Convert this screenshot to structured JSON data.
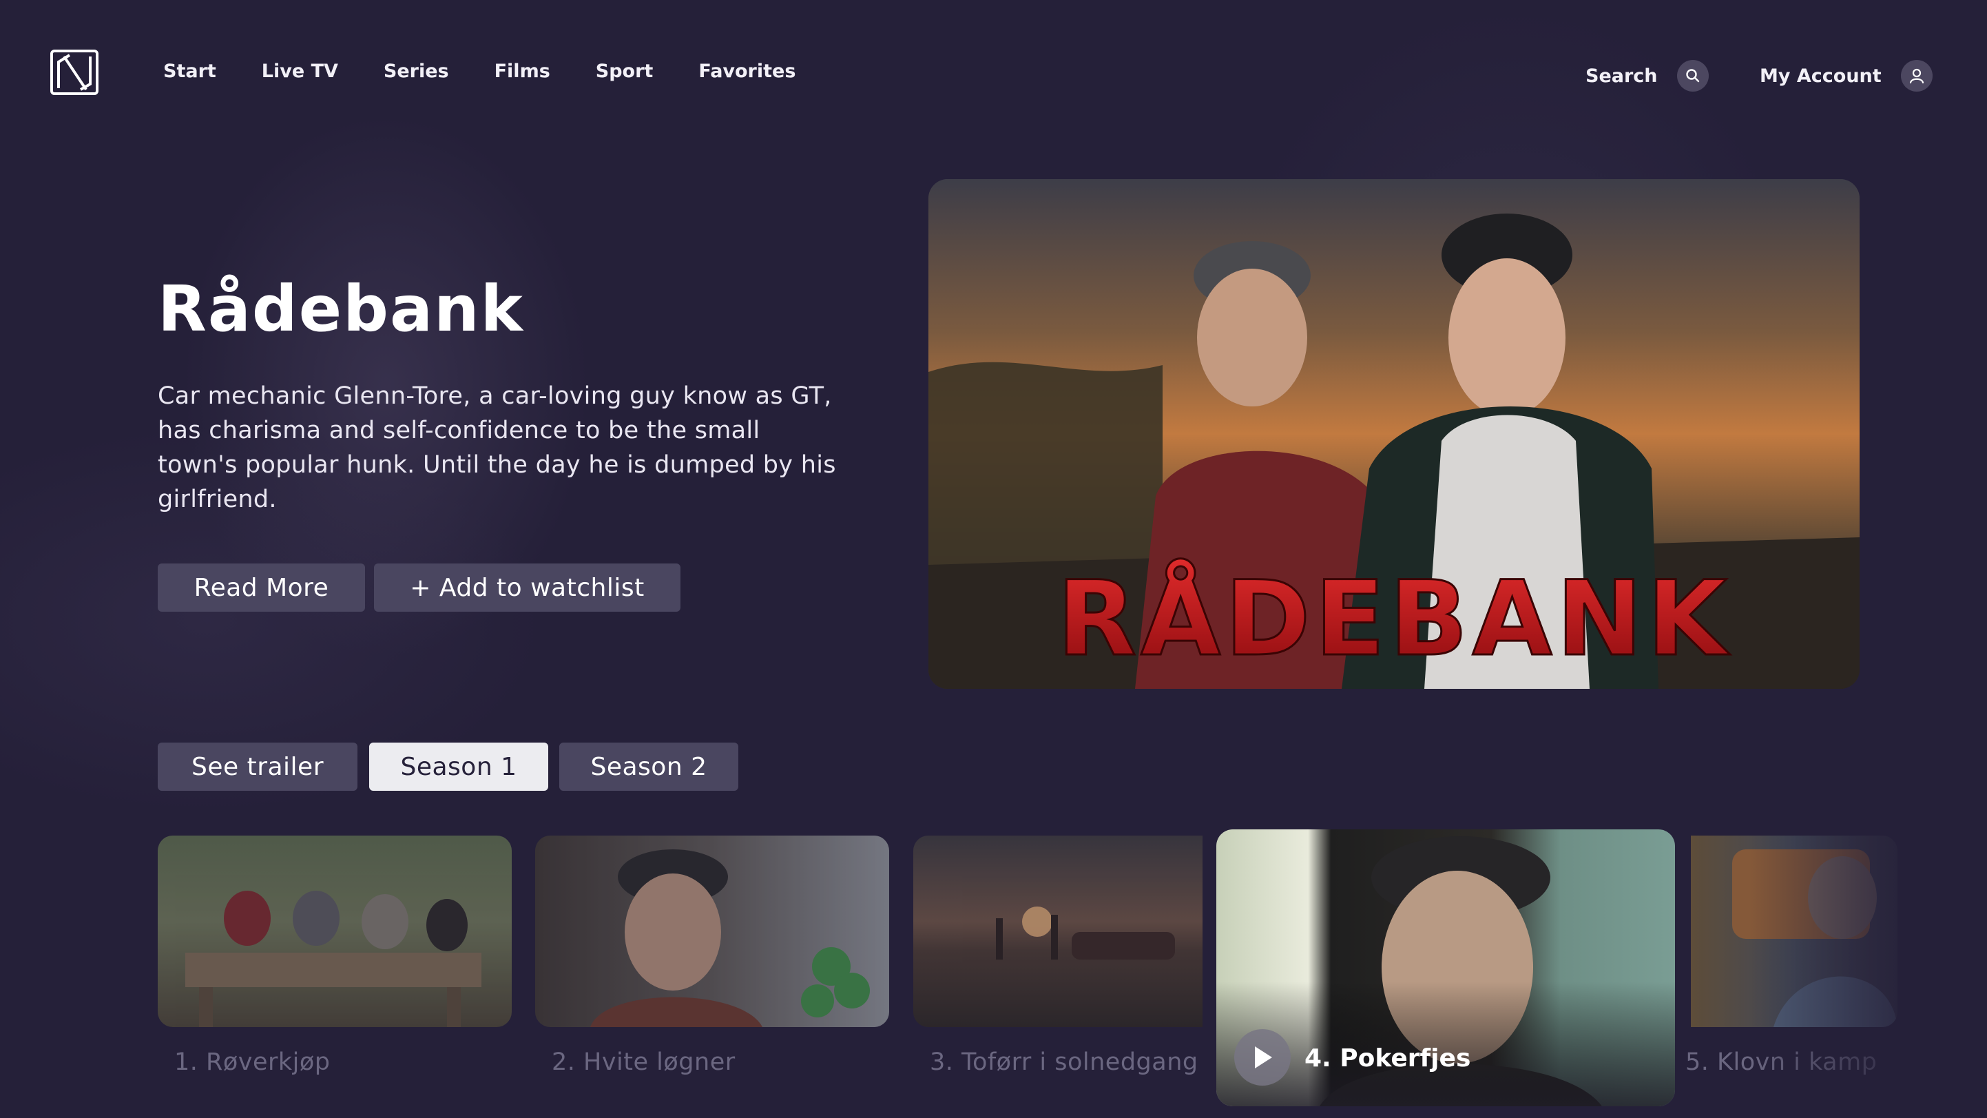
{
  "nav": {
    "items": [
      "Start",
      "Live TV",
      "Series",
      "Films",
      "Sport",
      "Favorites"
    ],
    "search_label": "Search",
    "account_label": "My Account",
    "logo_icon": "n-logo-icon",
    "search_icon": "search-icon",
    "account_icon": "user-icon"
  },
  "hero": {
    "title": "Rådebank",
    "description": "Car mechanic Glenn-Tore, a car-loving guy know as GT, has charisma and self-confidence to be the small town's popular hunk. Until the day he is dumped by his girlfriend.",
    "read_more": "Read More",
    "watchlist": "+ Add to watchlist",
    "poster_title": "RÅDEBANK"
  },
  "tabs": {
    "trailer": "See trailer",
    "season1": "Season 1",
    "season2": "Season 2",
    "active": "Season 1"
  },
  "episodes": [
    {
      "label": "1. Røverkjøp"
    },
    {
      "label": "2. Hvite løgner"
    },
    {
      "label": "3. Toførr i solnedgang"
    },
    {
      "label": "4. Pokerfjes",
      "featured": true
    },
    {
      "label": "5. Klovn i kamp"
    }
  ],
  "colors": {
    "background": "#252039",
    "button": "#4a4660",
    "active_tab": "#ececf0",
    "poster_red": "#c4161c"
  }
}
